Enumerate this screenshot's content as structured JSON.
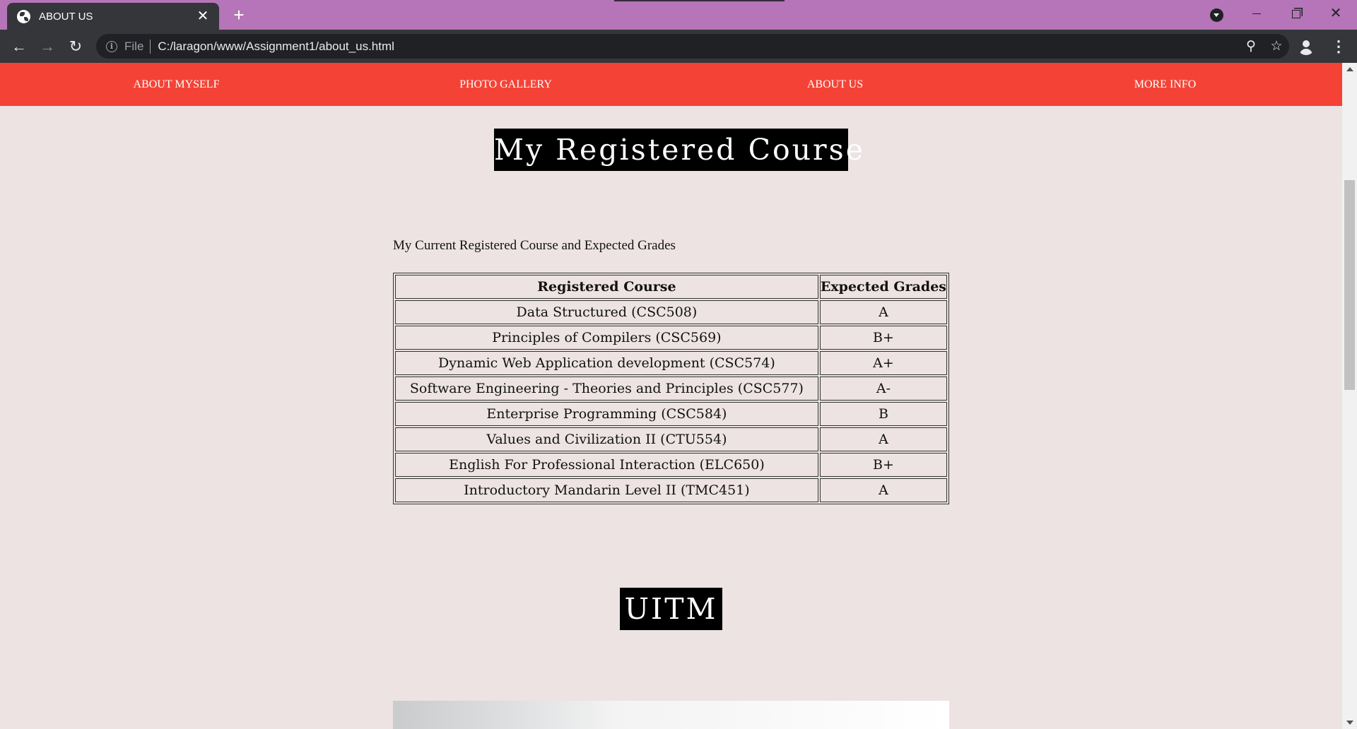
{
  "browser": {
    "tab_title": "ABOUT US",
    "tab_close_glyph": "✕",
    "new_tab_glyph": "+",
    "scheme_label": "File",
    "url": "C:/laragon/www/Assignment1/about_us.html",
    "back_glyph": "←",
    "forward_glyph": "→",
    "reload_glyph": "↻",
    "zoom_glyph": "⚲",
    "star_glyph": "☆",
    "menu_glyph": "⋮",
    "info_glyph": "i",
    "close_window_glyph": "✕"
  },
  "site_nav": {
    "items": [
      {
        "label": "ABOUT MYSELF"
      },
      {
        "label": "PHOTO GALLERY"
      },
      {
        "label": "ABOUT US"
      },
      {
        "label": "MORE INFO"
      }
    ]
  },
  "courses_section": {
    "heading": "My Registered Course",
    "intro": "My Current Registered Course and Expected Grades",
    "table": {
      "headers": [
        "Registered Course",
        "Expected Grades"
      ],
      "rows": [
        {
          "course": "Data Structured (CSC508)",
          "grade": "A"
        },
        {
          "course": "Principles of Compilers (CSC569)",
          "grade": "B+"
        },
        {
          "course": "Dynamic Web Application development (CSC574)",
          "grade": "A+"
        },
        {
          "course": "Software Engineering - Theories and Principles (CSC577)",
          "grade": "A-"
        },
        {
          "course": "Enterprise Programming (CSC584)",
          "grade": "B"
        },
        {
          "course": "Values and Civilization II (CTU554)",
          "grade": "A"
        },
        {
          "course": "English For Professional Interaction (ELC650)",
          "grade": "B+"
        },
        {
          "course": "Introductory Mandarin Level II (TMC451)",
          "grade": "A"
        }
      ]
    }
  },
  "uitm_section": {
    "heading": "UITM"
  },
  "colors": {
    "tabbar": "#b575b8",
    "toolbar": "#35363a",
    "nav_bar": "#f44336",
    "page_bg": "#ede3e3",
    "heading_bg": "#000000"
  }
}
